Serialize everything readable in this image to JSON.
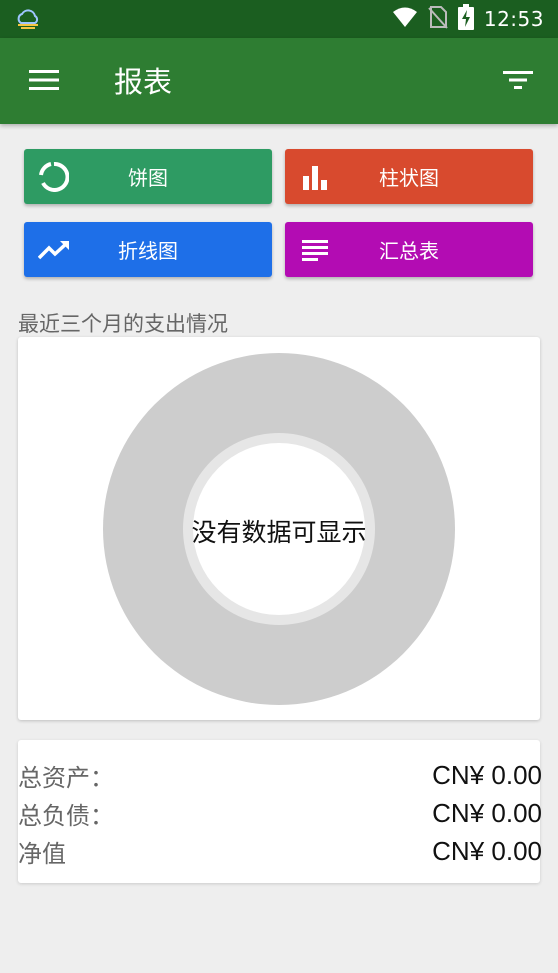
{
  "status_bar": {
    "time": "12:53",
    "icons": [
      "weather-cloud-icon",
      "wifi-icon",
      "no-sim-icon",
      "battery-charging-icon"
    ]
  },
  "app_bar": {
    "title": "报表",
    "menu_icon": "hamburger-menu-icon",
    "filter_icon": "filter-icon",
    "color": "#2e7d32",
    "status_color": "#1b5e20"
  },
  "report_buttons": [
    {
      "label": "饼图",
      "icon": "pie-chart-icon",
      "color": "#2e9b63"
    },
    {
      "label": "柱状图",
      "icon": "bar-chart-icon",
      "color": "#d84a2e"
    },
    {
      "label": "折线图",
      "icon": "line-chart-icon",
      "color": "#1e6fe8"
    },
    {
      "label": "汇总表",
      "icon": "list-icon",
      "color": "#b30cb3"
    }
  ],
  "chart_section": {
    "title": "最近三个月的支出情况",
    "empty_text": "没有数据可显示"
  },
  "summary": {
    "rows": [
      {
        "label": "总资产：",
        "value": "CN¥ 0.00"
      },
      {
        "label": "总负债：",
        "value": "CN¥ 0.00"
      },
      {
        "label": "净值",
        "value": "CN¥ 0.00"
      }
    ]
  }
}
